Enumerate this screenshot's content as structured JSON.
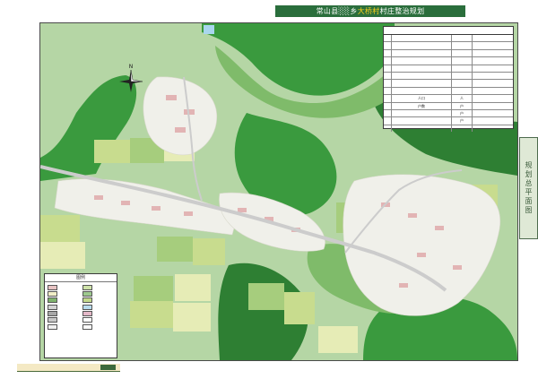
{
  "sheet": {
    "title_prefix": "常山县",
    "title_mid": "乡",
    "title_highlight": "大桥村",
    "title_suffix": "村庄整治规划",
    "side_tab_label": "规划总平面图",
    "footer_label": ""
  },
  "stats_table": {
    "caption": "",
    "headers": [
      "",
      "",
      ""
    ],
    "rows": [
      {
        "group": "",
        "item": "",
        "unit": "",
        "value": ""
      },
      {
        "group": "",
        "item": "",
        "unit": "",
        "value": ""
      },
      {
        "group": "",
        "item": "",
        "unit": "",
        "value": ""
      },
      {
        "group": "",
        "item": "",
        "unit": "",
        "value": ""
      },
      {
        "group": "",
        "item": "",
        "unit": "",
        "value": ""
      },
      {
        "group": "",
        "item": "",
        "unit": "",
        "value": ""
      },
      {
        "group": "",
        "item": "",
        "unit": "",
        "value": ""
      },
      {
        "group": "",
        "item": "人口",
        "unit": "人",
        "value": ""
      },
      {
        "group": "",
        "item": "户数",
        "unit": "户",
        "value": ""
      },
      {
        "group": "",
        "item": "",
        "unit": "户",
        "value": ""
      },
      {
        "group": "",
        "item": "",
        "unit": "户",
        "value": ""
      },
      {
        "group": "",
        "item": "",
        "unit": "",
        "value": ""
      }
    ]
  },
  "legend": {
    "title": "图例",
    "items": [
      {
        "label": "",
        "color": "#e7c3c3"
      },
      {
        "label": "",
        "color": "#cfe3a9"
      },
      {
        "label": "",
        "color": "#f1eec7"
      },
      {
        "label": "",
        "color": "#9ec98f"
      },
      {
        "label": "",
        "color": "#7fb36d"
      },
      {
        "label": "",
        "color": "#c3d98c"
      },
      {
        "label": "",
        "color": "#d3d3d3"
      },
      {
        "label": "",
        "color": "#b9dcef"
      },
      {
        "label": "",
        "color": "#a8a8a8"
      },
      {
        "label": "",
        "color": "#e4b8c8"
      },
      {
        "label": "",
        "color": "#c8c8c8"
      },
      {
        "label": "",
        "color": "#ffffff"
      },
      {
        "label": "",
        "color": "#f0f0f0"
      },
      {
        "label": "",
        "color": "#ffffff"
      }
    ]
  },
  "map": {
    "north_label": "N",
    "colors": {
      "base": "#b5d6a5",
      "forest": "#3a9a3e",
      "forest_dark": "#2e7f33",
      "hill": "#7fbb6a",
      "field_a": "#c8dc8e",
      "field_b": "#a6cd7d",
      "field_c": "#e6ecb6",
      "village": "#f0f0ea",
      "roof_pink": "#e2b4b4",
      "road": "#cccccc",
      "water": "#a9d6ee"
    }
  }
}
